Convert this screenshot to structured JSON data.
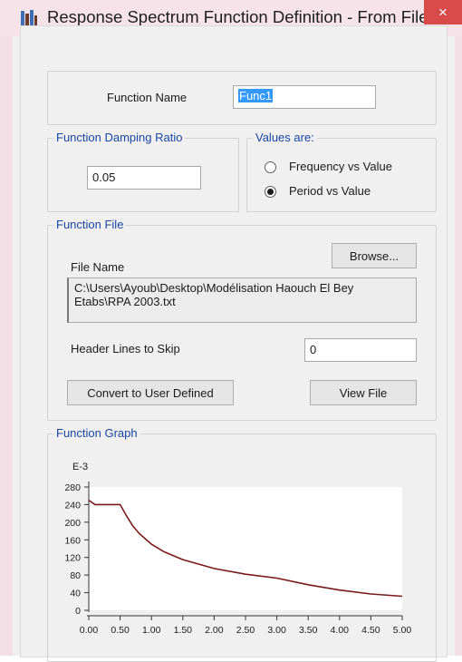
{
  "window": {
    "title": "Response Spectrum Function Definition - From File",
    "close_glyph": "×"
  },
  "function_name": {
    "label": "Function Name",
    "value": "Func1"
  },
  "damping": {
    "title": "Function Damping Ratio",
    "value": "0.05"
  },
  "values_are": {
    "title": "Values are:",
    "options": [
      {
        "label": "Frequency vs Value",
        "checked": false
      },
      {
        "label": "Period vs Value",
        "checked": true
      }
    ]
  },
  "function_file": {
    "title": "Function File",
    "browse_label": "Browse...",
    "file_name_label": "File Name",
    "file_path": "C:\\Users\\Ayoub\\Desktop\\Modélisation Haouch El Bey Etabs\\RPA 2003.txt",
    "header_lines_label": "Header Lines to Skip",
    "header_lines_value": "0",
    "convert_label": "Convert to User Defined",
    "view_file_label": "View File"
  },
  "graph": {
    "title": "Function Graph"
  },
  "chart_data": {
    "type": "line",
    "xlabel": "",
    "ylabel": "",
    "y_exponent_label": "E-3",
    "xlim": [
      0,
      5
    ],
    "ylim": [
      0,
      280
    ],
    "x_ticks": [
      "0.00",
      "0.50",
      "1.00",
      "1.50",
      "2.00",
      "2.50",
      "3.00",
      "3.50",
      "4.00",
      "4.50",
      "5.00"
    ],
    "y_ticks": [
      "0",
      "40",
      "80",
      "120",
      "160",
      "200",
      "240",
      "280"
    ],
    "line_color": "#7a1a1a",
    "series": [
      {
        "x": [
          0,
          0.1,
          0.2,
          0.3,
          0.5,
          0.6,
          0.7,
          0.8,
          1.0,
          1.2,
          1.5,
          2.0,
          2.5,
          3.0,
          3.5,
          4.0,
          4.5,
          5.0
        ],
        "values": [
          250,
          240,
          240,
          240,
          240,
          215,
          192,
          175,
          150,
          133,
          115,
          95,
          82,
          73,
          58,
          46,
          37,
          32
        ]
      }
    ]
  }
}
